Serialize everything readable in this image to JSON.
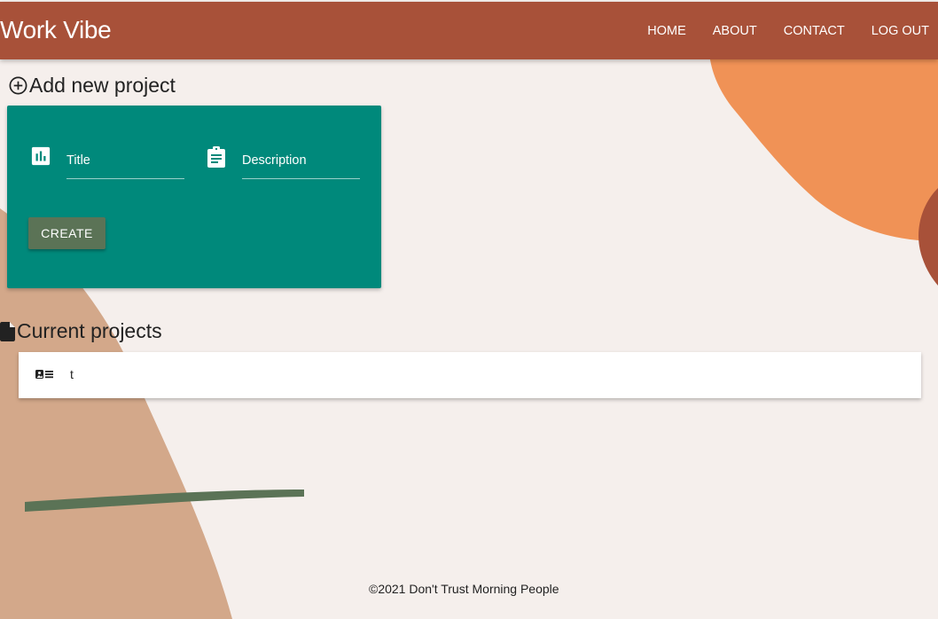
{
  "navbar": {
    "brand": "Work Vibe",
    "links": [
      "HOME",
      "ABOUT",
      "CONTACT",
      "LOG OUT"
    ]
  },
  "add_project": {
    "heading": "Add new project",
    "title_label": "Title",
    "description_label": "Description",
    "create_label": "CREATE"
  },
  "current_projects": {
    "heading": "Current projects",
    "items": [
      {
        "name": "t"
      }
    ]
  },
  "footer": {
    "text": "©2021 Don't Trust Morning People"
  },
  "colors": {
    "navbar": "#a85139",
    "card": "#00897b",
    "button": "#5b7356",
    "background": "#f5efec",
    "blob_orange": "#f09256",
    "blob_tan": "#d3a88a"
  },
  "icons": {
    "add": "add-circle-outline-icon",
    "current": "file-icon",
    "title_field": "bar-chart-icon",
    "description_field": "clipboard-icon",
    "project_item": "picture-list-icon"
  }
}
